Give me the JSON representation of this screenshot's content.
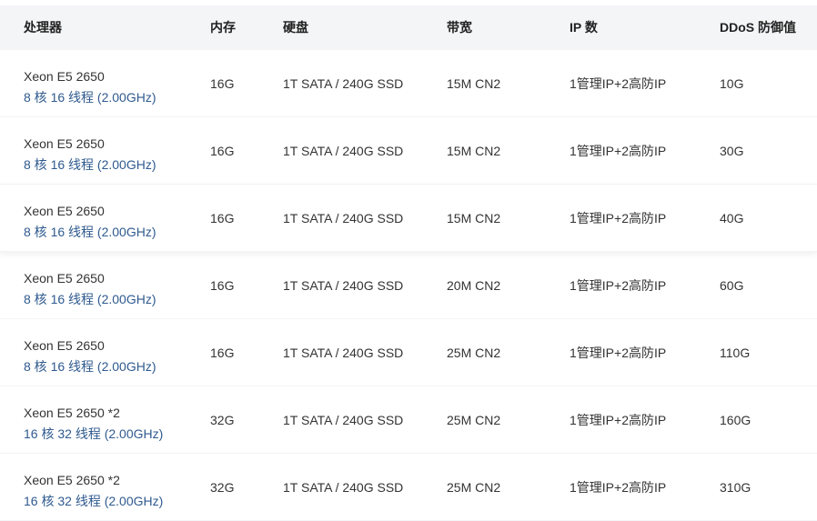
{
  "columns": [
    "处理器",
    "内存",
    "硬盘",
    "带宽",
    "IP 数",
    "DDoS 防御值"
  ],
  "rows": [
    {
      "cpu_model": "Xeon E5 2650",
      "cpu_detail": "8 核 16 线程 (2.00GHz)",
      "memory": "16G",
      "disk": "1T SATA / 240G SSD",
      "bandwidth": "15M CN2",
      "ip": "1管理IP+2高防IP",
      "ddos": "10G"
    },
    {
      "cpu_model": "Xeon E5 2650",
      "cpu_detail": "8 核 16 线程 (2.00GHz)",
      "memory": "16G",
      "disk": "1T SATA / 240G SSD",
      "bandwidth": "15M CN2",
      "ip": "1管理IP+2高防IP",
      "ddos": "30G"
    },
    {
      "cpu_model": "Xeon E5 2650",
      "cpu_detail": "8 核 16 线程 (2.00GHz)",
      "memory": "16G",
      "disk": "1T SATA / 240G SSD",
      "bandwidth": "15M CN2",
      "ip": "1管理IP+2高防IP",
      "ddos": "40G"
    },
    {
      "cpu_model": "Xeon E5 2650",
      "cpu_detail": "8 核 16 线程 (2.00GHz)",
      "memory": "16G",
      "disk": "1T SATA / 240G SSD",
      "bandwidth": "20M CN2",
      "ip": "1管理IP+2高防IP",
      "ddos": "60G"
    },
    {
      "cpu_model": "Xeon E5 2650",
      "cpu_detail": "8 核 16 线程 (2.00GHz)",
      "memory": "16G",
      "disk": "1T SATA / 240G SSD",
      "bandwidth": "25M CN2",
      "ip": "1管理IP+2高防IP",
      "ddos": "110G"
    },
    {
      "cpu_model": "Xeon E5 2650 *2",
      "cpu_detail": "16 核 32 线程 (2.00GHz)",
      "memory": "32G",
      "disk": "1T SATA / 240G SSD",
      "bandwidth": "25M CN2",
      "ip": "1管理IP+2高防IP",
      "ddos": "160G"
    },
    {
      "cpu_model": "Xeon E5 2650 *2",
      "cpu_detail": "16 核 32 线程 (2.00GHz)",
      "memory": "32G",
      "disk": "1T SATA / 240G SSD",
      "bandwidth": "25M CN2",
      "ip": "1管理IP+2高防IP",
      "ddos": "310G"
    }
  ],
  "colors": {
    "header_bg": "#f4f5f7",
    "cpu_detail": "#2f5a8f",
    "text": "#333333"
  }
}
